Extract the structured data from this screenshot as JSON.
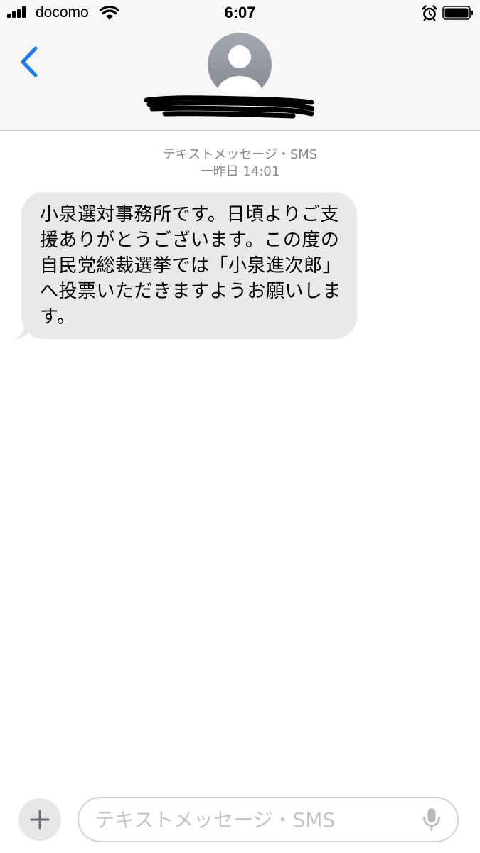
{
  "status_bar": {
    "carrier": "docomo",
    "time": "6:07"
  },
  "conversation": {
    "service_label": "テキストメッセージ・SMS",
    "timestamp": "一昨日 14:01",
    "messages": [
      {
        "direction": "incoming",
        "text": "小泉選対事務所です。日頃よりご支援ありがとうございます。この度の自民党総裁選挙では「小泉進次郎」へ投票いただきますようお願いします。"
      }
    ]
  },
  "input_bar": {
    "placeholder": "テキストメッセージ・SMS",
    "value": ""
  },
  "icons": {
    "back": "chevron-left-icon",
    "avatar": "person-silhouette-icon",
    "add": "plus-icon",
    "mic": "microphone-icon",
    "wifi": "wifi-icon",
    "alarm": "alarm-clock-icon",
    "battery": "battery-full-icon"
  },
  "colors": {
    "accent": "#1a7cf5",
    "bubble_incoming": "#e9e9eb",
    "meta_text": "#8a8a8e",
    "header_bg": "#f7f7f7"
  }
}
